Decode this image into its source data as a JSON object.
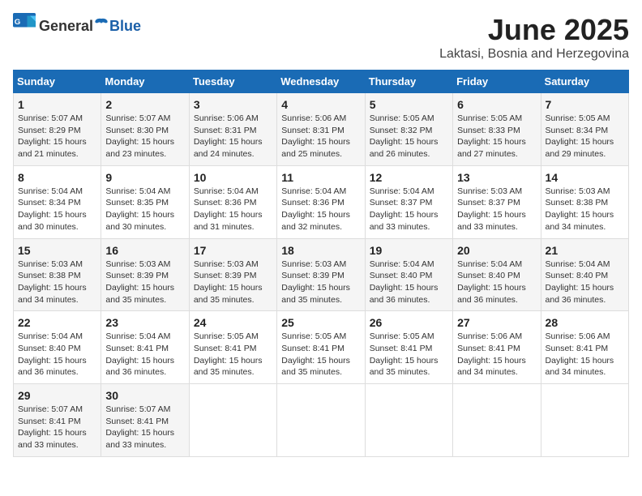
{
  "logo": {
    "general": "General",
    "blue": "Blue"
  },
  "title": "June 2025",
  "subtitle": "Laktasi, Bosnia and Herzegovina",
  "days_of_week": [
    "Sunday",
    "Monday",
    "Tuesday",
    "Wednesday",
    "Thursday",
    "Friday",
    "Saturday"
  ],
  "weeks": [
    [
      {
        "day": "1",
        "info": "Sunrise: 5:07 AM\nSunset: 8:29 PM\nDaylight: 15 hours\nand 21 minutes."
      },
      {
        "day": "2",
        "info": "Sunrise: 5:07 AM\nSunset: 8:30 PM\nDaylight: 15 hours\nand 23 minutes."
      },
      {
        "day": "3",
        "info": "Sunrise: 5:06 AM\nSunset: 8:31 PM\nDaylight: 15 hours\nand 24 minutes."
      },
      {
        "day": "4",
        "info": "Sunrise: 5:06 AM\nSunset: 8:31 PM\nDaylight: 15 hours\nand 25 minutes."
      },
      {
        "day": "5",
        "info": "Sunrise: 5:05 AM\nSunset: 8:32 PM\nDaylight: 15 hours\nand 26 minutes."
      },
      {
        "day": "6",
        "info": "Sunrise: 5:05 AM\nSunset: 8:33 PM\nDaylight: 15 hours\nand 27 minutes."
      },
      {
        "day": "7",
        "info": "Sunrise: 5:05 AM\nSunset: 8:34 PM\nDaylight: 15 hours\nand 29 minutes."
      }
    ],
    [
      {
        "day": "8",
        "info": "Sunrise: 5:04 AM\nSunset: 8:34 PM\nDaylight: 15 hours\nand 30 minutes."
      },
      {
        "day": "9",
        "info": "Sunrise: 5:04 AM\nSunset: 8:35 PM\nDaylight: 15 hours\nand 30 minutes."
      },
      {
        "day": "10",
        "info": "Sunrise: 5:04 AM\nSunset: 8:36 PM\nDaylight: 15 hours\nand 31 minutes."
      },
      {
        "day": "11",
        "info": "Sunrise: 5:04 AM\nSunset: 8:36 PM\nDaylight: 15 hours\nand 32 minutes."
      },
      {
        "day": "12",
        "info": "Sunrise: 5:04 AM\nSunset: 8:37 PM\nDaylight: 15 hours\nand 33 minutes."
      },
      {
        "day": "13",
        "info": "Sunrise: 5:03 AM\nSunset: 8:37 PM\nDaylight: 15 hours\nand 33 minutes."
      },
      {
        "day": "14",
        "info": "Sunrise: 5:03 AM\nSunset: 8:38 PM\nDaylight: 15 hours\nand 34 minutes."
      }
    ],
    [
      {
        "day": "15",
        "info": "Sunrise: 5:03 AM\nSunset: 8:38 PM\nDaylight: 15 hours\nand 34 minutes."
      },
      {
        "day": "16",
        "info": "Sunrise: 5:03 AM\nSunset: 8:39 PM\nDaylight: 15 hours\nand 35 minutes."
      },
      {
        "day": "17",
        "info": "Sunrise: 5:03 AM\nSunset: 8:39 PM\nDaylight: 15 hours\nand 35 minutes."
      },
      {
        "day": "18",
        "info": "Sunrise: 5:03 AM\nSunset: 8:39 PM\nDaylight: 15 hours\nand 35 minutes."
      },
      {
        "day": "19",
        "info": "Sunrise: 5:04 AM\nSunset: 8:40 PM\nDaylight: 15 hours\nand 36 minutes."
      },
      {
        "day": "20",
        "info": "Sunrise: 5:04 AM\nSunset: 8:40 PM\nDaylight: 15 hours\nand 36 minutes."
      },
      {
        "day": "21",
        "info": "Sunrise: 5:04 AM\nSunset: 8:40 PM\nDaylight: 15 hours\nand 36 minutes."
      }
    ],
    [
      {
        "day": "22",
        "info": "Sunrise: 5:04 AM\nSunset: 8:40 PM\nDaylight: 15 hours\nand 36 minutes."
      },
      {
        "day": "23",
        "info": "Sunrise: 5:04 AM\nSunset: 8:41 PM\nDaylight: 15 hours\nand 36 minutes."
      },
      {
        "day": "24",
        "info": "Sunrise: 5:05 AM\nSunset: 8:41 PM\nDaylight: 15 hours\nand 35 minutes."
      },
      {
        "day": "25",
        "info": "Sunrise: 5:05 AM\nSunset: 8:41 PM\nDaylight: 15 hours\nand 35 minutes."
      },
      {
        "day": "26",
        "info": "Sunrise: 5:05 AM\nSunset: 8:41 PM\nDaylight: 15 hours\nand 35 minutes."
      },
      {
        "day": "27",
        "info": "Sunrise: 5:06 AM\nSunset: 8:41 PM\nDaylight: 15 hours\nand 34 minutes."
      },
      {
        "day": "28",
        "info": "Sunrise: 5:06 AM\nSunset: 8:41 PM\nDaylight: 15 hours\nand 34 minutes."
      }
    ],
    [
      {
        "day": "29",
        "info": "Sunrise: 5:07 AM\nSunset: 8:41 PM\nDaylight: 15 hours\nand 33 minutes."
      },
      {
        "day": "30",
        "info": "Sunrise: 5:07 AM\nSunset: 8:41 PM\nDaylight: 15 hours\nand 33 minutes."
      },
      null,
      null,
      null,
      null,
      null
    ]
  ]
}
